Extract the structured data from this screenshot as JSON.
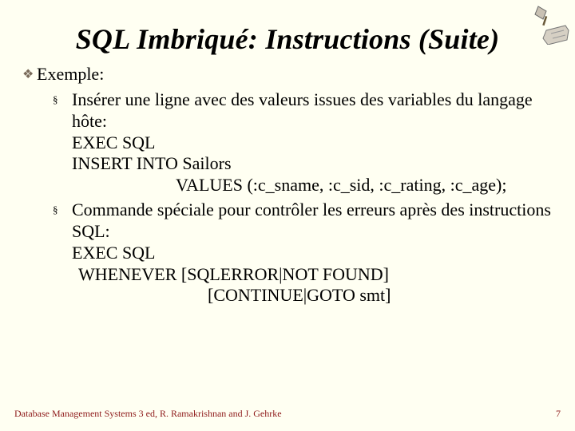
{
  "title": "SQL Imbriqué: Instructions (Suite)",
  "lvl1": {
    "exemple": "Exemple:"
  },
  "b1": {
    "lead": "Insérer une ligne avec des valeurs issues des variables du langage hôte:",
    "l1": "EXEC SQL",
    "l2": "INSERT INTO Sailors",
    "l3": "VALUES (:c_sname, :c_sid, :c_rating, :c_age);"
  },
  "b2": {
    "lead": "Commande spéciale pour contrôler les erreurs après des instructions SQL:",
    "l1": "EXEC SQL",
    "l2": "WHENEVER [SQLERROR|NOT FOUND]",
    "l3": "[CONTINUE|GOTO smt]"
  },
  "footer": {
    "credit": "Database Management Systems 3 ed, R. Ramakrishnan and J. Gehrke",
    "page": "7"
  }
}
